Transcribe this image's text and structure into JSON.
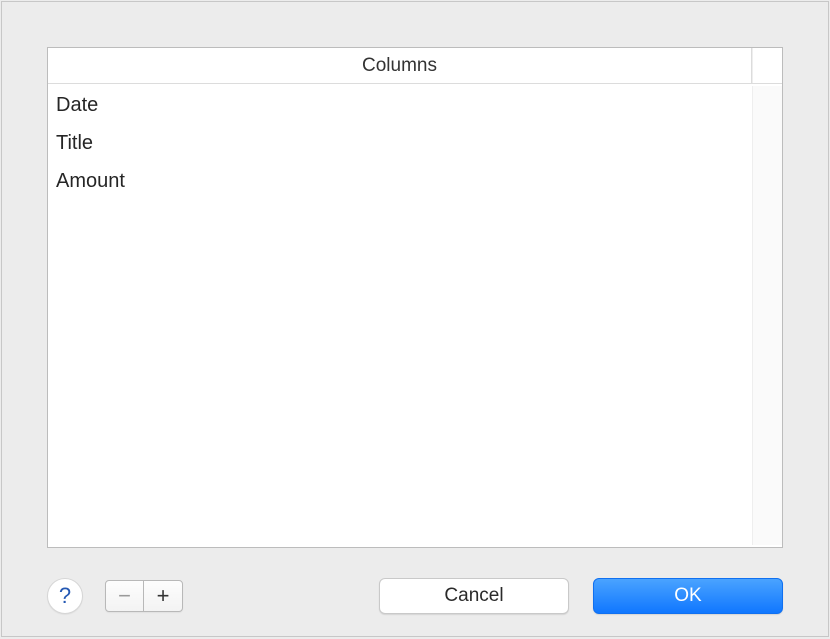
{
  "table": {
    "header": "Columns",
    "rows": [
      "Date",
      "Title",
      "Amount"
    ]
  },
  "footer": {
    "help_symbol": "?",
    "remove_symbol": "−",
    "add_symbol": "+",
    "cancel_label": "Cancel",
    "ok_label": "OK"
  }
}
